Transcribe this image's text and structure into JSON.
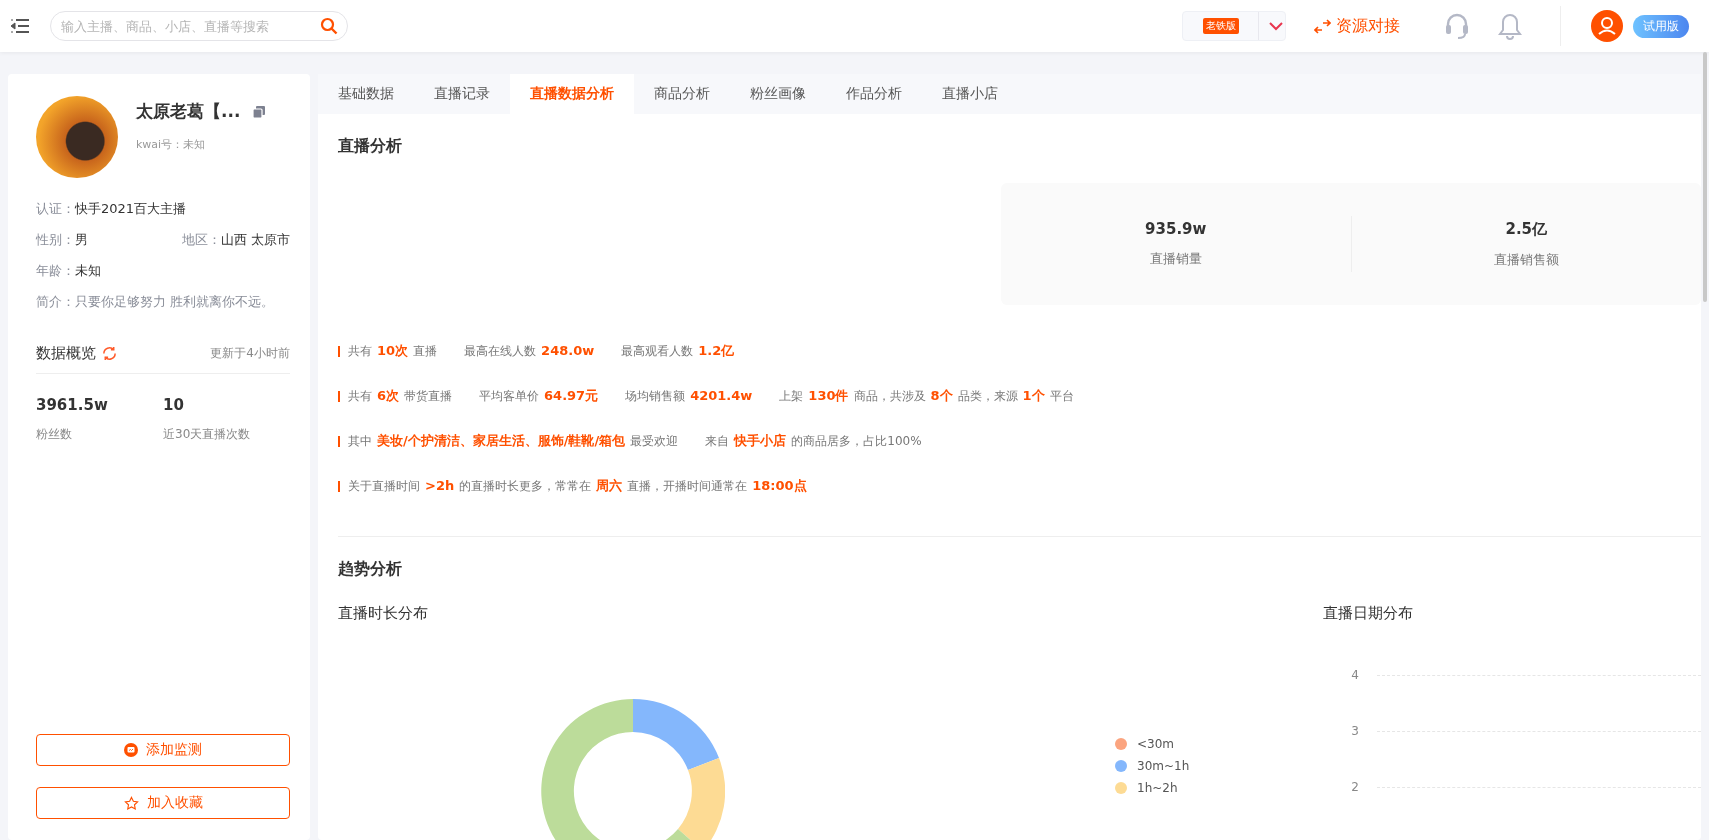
{
  "topbar": {
    "search": {
      "placeholder": "输入主播、商品、小店、直播等搜索"
    },
    "version_badge": "老铁版",
    "resource_link": "资源对接",
    "trial_badge": "试用版"
  },
  "profile": {
    "name": "太原老葛【...",
    "kwai_id": "kwai号：未知",
    "rows": [
      [
        {
          "label": "认证：",
          "value": "快手2021百大主播"
        }
      ],
      [
        {
          "label": "性别：",
          "value": "男"
        },
        {
          "label": "地区：",
          "value": "山西 太原市"
        }
      ],
      [
        {
          "label": "年龄：",
          "value": "未知"
        }
      ]
    ],
    "intro": {
      "label": "简介：",
      "value": "只要你足够努力 胜利就离你不远。"
    }
  },
  "overview": {
    "title": "数据概览",
    "updated": "更新于4小时前",
    "stats": [
      {
        "value": "3961.5w",
        "label": "粉丝数"
      },
      {
        "value": "10",
        "label": "近30天直播次数"
      }
    ]
  },
  "buttons": [
    {
      "label": "添加监测",
      "kind": "monitor"
    },
    {
      "label": "加入收藏",
      "kind": "favorite"
    }
  ],
  "tabs": [
    {
      "label": "基础数据",
      "selected": false
    },
    {
      "label": "直播记录",
      "selected": false
    },
    {
      "label": "直播数据分析",
      "selected": true
    },
    {
      "label": "商品分析",
      "selected": false
    },
    {
      "label": "粉丝画像",
      "selected": false
    },
    {
      "label": "作品分析",
      "selected": false
    },
    {
      "label": "直播小店",
      "selected": false
    }
  ],
  "live_analysis": {
    "title": "直播分析",
    "stats": [
      {
        "value": "935.9w",
        "label": "直播销量"
      },
      {
        "value": "2.5亿",
        "label": "直播销售额"
      }
    ],
    "summary_lines": [
      [
        [
          {
            "text": "共有",
            "emphasis": false
          },
          {
            "text": "10次",
            "emphasis": true
          },
          {
            "text": "直播",
            "emphasis": false
          }
        ],
        [
          {
            "text": "最高在线人数",
            "emphasis": false
          },
          {
            "text": "248.0w",
            "emphasis": true
          }
        ],
        [
          {
            "text": "最高观看人数",
            "emphasis": false
          },
          {
            "text": "1.2亿",
            "emphasis": true
          }
        ]
      ],
      [
        [
          {
            "text": "共有",
            "emphasis": false
          },
          {
            "text": "6次",
            "emphasis": true
          },
          {
            "text": "带货直播",
            "emphasis": false
          }
        ],
        [
          {
            "text": "平均客单价",
            "emphasis": false
          },
          {
            "text": "64.97元",
            "emphasis": true
          }
        ],
        [
          {
            "text": "场均销售额",
            "emphasis": false
          },
          {
            "text": "4201.4w",
            "emphasis": true
          }
        ],
        [
          {
            "text": "上架",
            "emphasis": false
          },
          {
            "text": "130件",
            "emphasis": true
          },
          {
            "text": "商品，共涉及",
            "emphasis": false
          },
          {
            "text": "8个",
            "emphasis": true
          },
          {
            "text": "品类，来源",
            "emphasis": false
          },
          {
            "text": "1个",
            "emphasis": true
          },
          {
            "text": "平台",
            "emphasis": false
          }
        ]
      ],
      [
        [
          {
            "text": "其中",
            "emphasis": false
          },
          {
            "text": "美妆/个护清洁、家居生活、服饰/鞋靴/箱包",
            "emphasis": true
          },
          {
            "text": "最受欢迎",
            "emphasis": false
          }
        ],
        [
          {
            "text": "来自",
            "emphasis": false
          },
          {
            "text": "快手小店",
            "emphasis": true
          },
          {
            "text": "的商品居多，占比100%",
            "emphasis": false
          }
        ]
      ],
      [
        [
          {
            "text": "关于直播时间",
            "emphasis": false
          },
          {
            "text": ">2h",
            "emphasis": true
          },
          {
            "text": "的直播时长更多，常常在",
            "emphasis": false
          },
          {
            "text": "周六",
            "emphasis": true
          },
          {
            "text": "直播，开播时间通常在",
            "emphasis": false
          },
          {
            "text": "18:00点",
            "emphasis": true
          }
        ]
      ]
    ]
  },
  "trend": {
    "title": "趋势分析",
    "duration_chart": {
      "title": "直播时长分布",
      "legend": [
        {
          "label": "<30m",
          "color": "#fba47f"
        },
        {
          "label": "30m~1h",
          "color": "#84b7fc"
        },
        {
          "label": "1h~2h",
          "color": "#fddb94"
        }
      ]
    },
    "date_chart": {
      "title": "直播日期分布",
      "y_ticks": [
        "4",
        "3",
        "2"
      ]
    }
  }
}
